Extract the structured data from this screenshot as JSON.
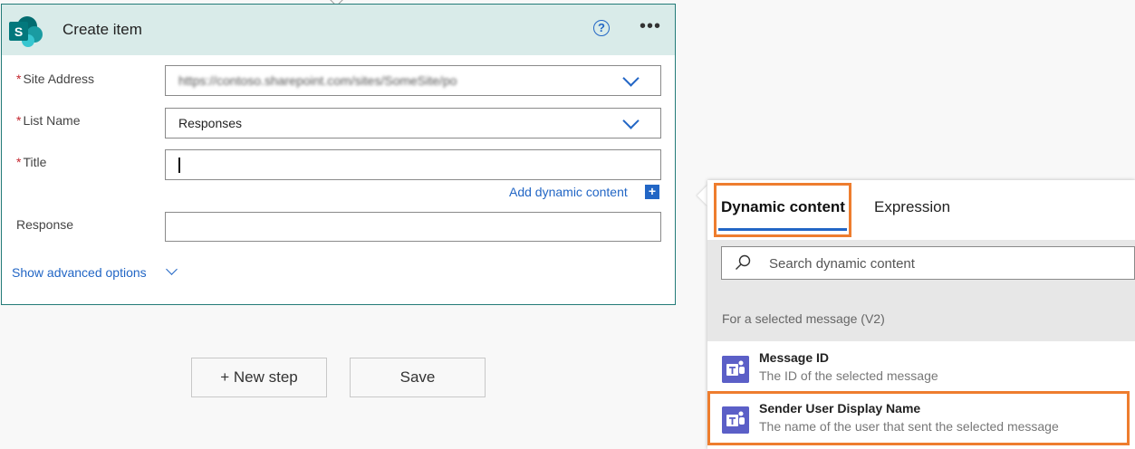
{
  "card": {
    "title": "Create item",
    "help_icon_glyph": "?",
    "more_icon_glyph": "•••",
    "logo_letter": "S",
    "fields": {
      "site_address": {
        "label": "Site Address",
        "required_mark": "*",
        "value": "https://contoso.sharepoint.com/sites/SomeSite/po"
      },
      "list_name": {
        "label": "List Name",
        "required_mark": "*",
        "value": "Responses"
      },
      "title": {
        "label": "Title",
        "required_mark": "*",
        "value": ""
      },
      "response": {
        "label": "Response",
        "value": ""
      }
    },
    "add_dynamic_label": "Add dynamic content",
    "add_dynamic_glyph": "+",
    "show_advanced_label": "Show advanced options"
  },
  "buttons": {
    "new_step": "+ New step",
    "save": "Save"
  },
  "dynamic_panel": {
    "tabs": [
      "Dynamic content",
      "Expression"
    ],
    "active_tab": "Dynamic content",
    "search_placeholder": "Search dynamic content",
    "section_title": "For a selected message (V2)",
    "items": [
      {
        "title": "Message ID",
        "description": "The ID of the selected message",
        "icon": "teams-icon"
      },
      {
        "title": "Sender User Display Name",
        "description": "The name of the user that sent the selected message",
        "icon": "teams-icon"
      }
    ]
  },
  "colors": {
    "accent": "#2266c5",
    "highlight": "#ee7d2e",
    "card_header": "#d9ebe9",
    "teams": "#5b5fc7",
    "sharepoint": "#036c70"
  }
}
